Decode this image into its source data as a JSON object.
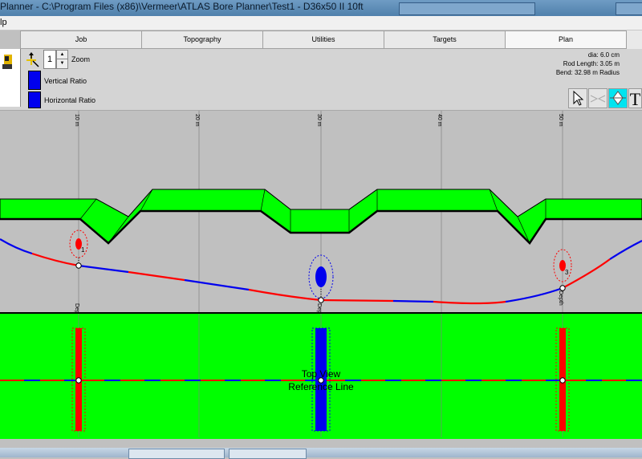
{
  "window": {
    "title": "Planner - C:\\Program Files (x86)\\Vermeer\\ATLAS Bore Planner\\Test1 - D36x50 II 10ft",
    "menu_visible": "lp"
  },
  "tabs": [
    {
      "label": "Job"
    },
    {
      "label": "Topography"
    },
    {
      "label": "Utilities"
    },
    {
      "label": "Targets"
    },
    {
      "label": "Plan",
      "active": true
    }
  ],
  "controls": {
    "zoom_value": "1",
    "zoom_label": "Zoom",
    "vertical_ratio_label": "Vertical Ratio",
    "horizontal_ratio_label": "Horizontal Ratio",
    "ratio_color": "#0000ee"
  },
  "info": {
    "dia": "dia: 6.0 cm",
    "rod_length": "Rod Length: 3.05 m",
    "bend": "Bend: 32.98 m Radius"
  },
  "tools": [
    {
      "icon": "pointer-arrow-icon"
    },
    {
      "icon": "bend-disabled-icon"
    },
    {
      "icon": "target-diamond-icon",
      "active": true
    },
    {
      "icon": "text-tool-icon",
      "label": "T"
    }
  ],
  "ruler": {
    "ticks": [
      "10 m",
      "20 m",
      "30 m",
      "40 m",
      "50 m"
    ],
    "tick_values_m": [
      10,
      20,
      30,
      40,
      50
    ]
  },
  "targets": [
    {
      "id": "1",
      "distance_m": 10,
      "kind": "Depth"
    },
    {
      "id": "2",
      "distance_m": 30,
      "kind": "Depth"
    },
    {
      "id": "3",
      "distance_m": 50,
      "kind": "Depth"
    }
  ],
  "plan_view": {
    "label_line1": "Top View",
    "label_line2": "Reference Line"
  },
  "colors": {
    "ground": "#00ff00",
    "background": "#c0c0c0",
    "bore_red": "#ff0000",
    "bore_blue": "#0000ee"
  }
}
